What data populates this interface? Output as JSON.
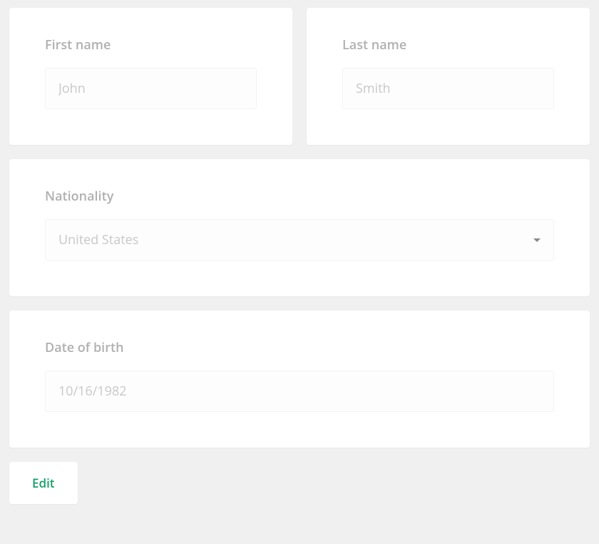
{
  "first_name": {
    "label": "First name",
    "placeholder": "John",
    "value": ""
  },
  "last_name": {
    "label": "Last name",
    "placeholder": "Smith",
    "value": ""
  },
  "nationality": {
    "label": "Nationality",
    "selected": "United States"
  },
  "dob": {
    "label": "Date of birth",
    "value": "10/16/1982"
  },
  "edit_button": "Edit"
}
